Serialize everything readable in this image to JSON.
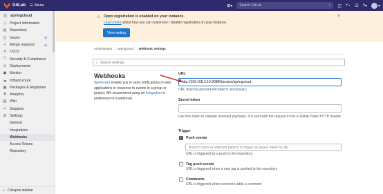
{
  "topbar": {
    "brand": "GitLab",
    "menu": "Menu",
    "search_placeholder": "Search GitLab"
  },
  "sidebar": {
    "project_initial": "S",
    "project_name": "springcloud",
    "items": [
      {
        "label": "Project information",
        "icon": "info-icon"
      },
      {
        "label": "Repository",
        "icon": "repo-icon"
      },
      {
        "label": "Issues",
        "icon": "issues-icon",
        "badge": "0"
      },
      {
        "label": "Merge requests",
        "icon": "merge-icon",
        "badge": "0"
      },
      {
        "label": "CI/CD",
        "icon": "rocket-icon"
      },
      {
        "label": "Security & Compliance",
        "icon": "shield-icon"
      },
      {
        "label": "Deployments",
        "icon": "deploy-icon"
      },
      {
        "label": "Monitor",
        "icon": "monitor-icon"
      },
      {
        "label": "Infrastructure",
        "icon": "cloud-icon"
      },
      {
        "label": "Packages & Registries",
        "icon": "package-icon"
      },
      {
        "label": "Analytics",
        "icon": "chart-icon"
      },
      {
        "label": "Wiki",
        "icon": "book-icon"
      },
      {
        "label": "Snippets",
        "icon": "snippet-icon"
      },
      {
        "label": "Settings",
        "icon": "gear-icon"
      }
    ],
    "sub_items": [
      "General",
      "Integrations",
      "Webhooks",
      "Access Tokens",
      "Repository"
    ],
    "collapse": "Collapse sidebar"
  },
  "alert": {
    "title": "Open registration is enabled on your instance.",
    "link": "Learn more",
    "text": " about how you can customize / disable registration on your instance.",
    "button": "View setting"
  },
  "breadcrumb": [
    "Administrator",
    "springcloud",
    "Webhook Settings"
  ],
  "search_settings_placeholder": "Search settings",
  "webhooks": {
    "title": "Webhooks",
    "desc_link": "Webhooks",
    "desc_a": " enable you to send notifications to web applications in response to events in a group or project. We recommend using an ",
    "desc_link2": "integration",
    "desc_b": " in preference to a webhook."
  },
  "form": {
    "url_label": "URL",
    "url_value": "http://192.168.3.10:30880/project/springcloud",
    "url_help": "URL must be percent-encoded if neccessary.",
    "token_label": "Secret token",
    "token_help": "Use this token to validate received payloads. It is sent with the request in the X-Gitlab-Token HTTP header.",
    "trigger_label": "Trigger",
    "push_label": "Push events",
    "branch_placeholder": "Branch name or wildcard pattern to trigger on (leave blank for all)",
    "push_help": "URL is triggered by a push to the repository",
    "tag_label": "Tag push events",
    "tag_help": "URL is triggered when a new tag is pushed to the repository",
    "comments_label": "Comments",
    "comments_help": "URL is triggered when someone adds a comment"
  }
}
